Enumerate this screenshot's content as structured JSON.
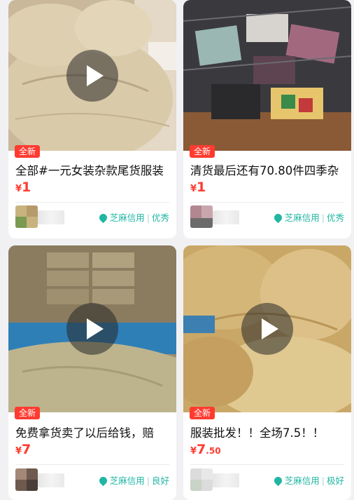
{
  "colors": {
    "accent": "#ff3b30",
    "credit": "#1fb6a3",
    "background": "#f1f1f3"
  },
  "cards": [
    {
      "badge": "全新",
      "title": "全部#一元女装杂款尾货服装",
      "price": {
        "currency": "¥",
        "integer": "1",
        "decimal": ""
      },
      "credit": {
        "label": "芝麻信用",
        "level": "优秀"
      },
      "has_video": true
    },
    {
      "badge": "全新",
      "title": "清货最后还有70.80件四季杂",
      "price": {
        "currency": "¥",
        "integer": "1",
        "decimal": ""
      },
      "credit": {
        "label": "芝麻信用",
        "level": "优秀"
      },
      "has_video": false
    },
    {
      "badge": "全新",
      "title": "免费拿货卖了以后给钱，赔",
      "price": {
        "currency": "¥",
        "integer": "7",
        "decimal": ""
      },
      "credit": {
        "label": "芝麻信用",
        "level": "良好"
      },
      "has_video": true
    },
    {
      "badge": "全新",
      "title": "服装批发！！全场7.5！！",
      "price": {
        "currency": "¥",
        "integer": "7",
        "decimal": ".50"
      },
      "credit": {
        "label": "芝麻信用",
        "level": "极好"
      },
      "has_video": true
    }
  ]
}
